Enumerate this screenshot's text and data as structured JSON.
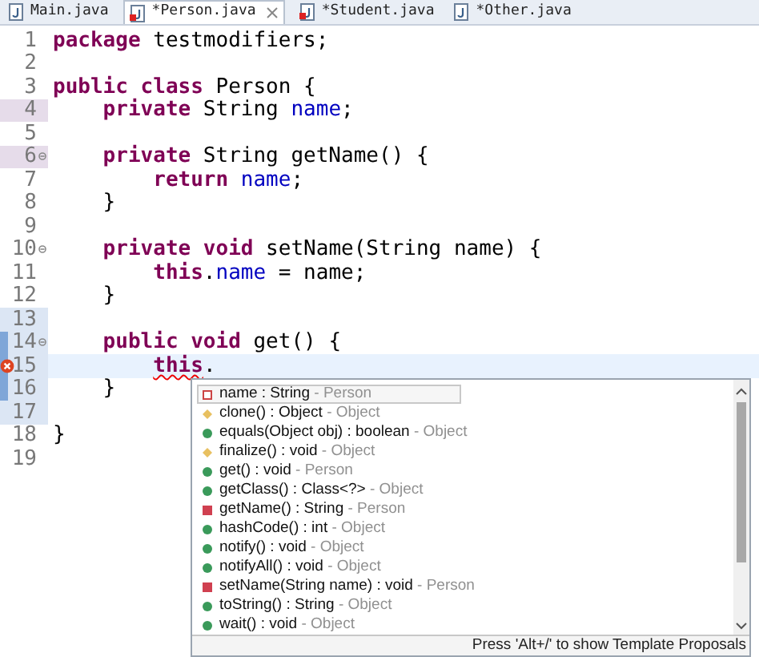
{
  "tabs": [
    {
      "label": "Main.java",
      "selected": false,
      "error": false,
      "closable": false
    },
    {
      "label": "*Person.java",
      "selected": true,
      "error": true,
      "closable": true
    },
    {
      "label": "*Student.java",
      "selected": false,
      "error": true,
      "closable": false
    },
    {
      "label": "*Other.java",
      "selected": false,
      "error": false,
      "closable": false
    }
  ],
  "editor": {
    "lines": [
      {
        "number": "1",
        "tokens": [
          {
            "text": "package",
            "kind": "keyword"
          },
          {
            "text": " testmodifiers;",
            "kind": "plain"
          }
        ]
      },
      {
        "number": "2"
      },
      {
        "number": "3",
        "tokens": [
          {
            "text": "public class",
            "kind": "keyword"
          },
          {
            "text": " Person {",
            "kind": "plain"
          }
        ]
      },
      {
        "number": "4",
        "kind": "occurrence",
        "tokens": [
          {
            "text": "    private",
            "kind": "keyword"
          },
          {
            "text": " String ",
            "kind": "plain"
          },
          {
            "text": "name",
            "kind": "field"
          },
          {
            "text": ";",
            "kind": "plain"
          }
        ]
      },
      {
        "number": "5"
      },
      {
        "number": "6",
        "kind": "occurrence",
        "fold": true,
        "tokens": [
          {
            "text": "    private",
            "kind": "keyword"
          },
          {
            "text": " String getName() {",
            "kind": "plain"
          }
        ]
      },
      {
        "number": "7",
        "tokens": [
          {
            "text": "        return ",
            "kind": "keyword"
          },
          {
            "text": "name",
            "kind": "field"
          },
          {
            "text": ";",
            "kind": "plain"
          }
        ]
      },
      {
        "number": "8",
        "tokens": [
          {
            "text": "    }",
            "kind": "plain"
          }
        ]
      },
      {
        "number": "9"
      },
      {
        "number": "10",
        "fold": true,
        "tokens": [
          {
            "text": "    private void",
            "kind": "keyword"
          },
          {
            "text": " setName(String name) {",
            "kind": "plain"
          }
        ]
      },
      {
        "number": "11",
        "tokens": [
          {
            "text": "        this",
            "kind": "keyword"
          },
          {
            "text": ".",
            "kind": "plain"
          },
          {
            "text": "name",
            "kind": "field"
          },
          {
            "text": " = name;",
            "kind": "plain"
          }
        ]
      },
      {
        "number": "12",
        "tokens": [
          {
            "text": "    }",
            "kind": "plain"
          }
        ]
      },
      {
        "number": "13",
        "kind": "edited"
      },
      {
        "number": "14",
        "kind": "added",
        "fold": true,
        "tokens": [
          {
            "text": "    public void",
            "kind": "keyword"
          },
          {
            "text": " get() {",
            "kind": "plain"
          }
        ]
      },
      {
        "number": "15",
        "kind": "added",
        "error": true,
        "current": true,
        "tokens": [
          {
            "text": "        this",
            "kind": "keyword_error"
          },
          {
            "text": ".",
            "kind": "plain"
          }
        ]
      },
      {
        "number": "16",
        "kind": "added",
        "tokens": [
          {
            "text": "    }",
            "kind": "plain"
          }
        ]
      },
      {
        "number": "17",
        "kind": "edited"
      },
      {
        "number": "18",
        "tokens": [
          {
            "text": "}",
            "kind": "plain"
          }
        ]
      },
      {
        "number": "19"
      }
    ]
  },
  "proposals": {
    "items": [
      {
        "kind": "field_private",
        "signature": "name : String",
        "owner": "- Person",
        "selected": true
      },
      {
        "kind": "method_protected",
        "signature": "clone() : Object",
        "owner": "- Object",
        "selected": false
      },
      {
        "kind": "method_public",
        "signature": "equals(Object obj) : boolean",
        "owner": "- Object",
        "selected": false
      },
      {
        "kind": "method_protected",
        "signature": "finalize() : void",
        "owner": "- Object",
        "selected": false
      },
      {
        "kind": "method_public",
        "signature": "get() : void",
        "owner": "- Person",
        "selected": false
      },
      {
        "kind": "method_public",
        "signature": "getClass() : Class<?>",
        "owner": "- Object",
        "selected": false
      },
      {
        "kind": "method_private",
        "signature": "getName() : String",
        "owner": "- Person",
        "selected": false
      },
      {
        "kind": "method_public",
        "signature": "hashCode() : int",
        "owner": "- Object",
        "selected": false
      },
      {
        "kind": "method_public",
        "signature": "notify() : void",
        "owner": "- Object",
        "selected": false
      },
      {
        "kind": "method_public",
        "signature": "notifyAll() : void",
        "owner": "- Object",
        "selected": false
      },
      {
        "kind": "method_private",
        "signature": "setName(String name) : void",
        "owner": "- Person",
        "selected": false
      },
      {
        "kind": "method_public",
        "signature": "toString() : String",
        "owner": "- Object",
        "selected": false
      },
      {
        "kind": "method_public",
        "signature": "wait() : void",
        "owner": "- Object",
        "selected": false
      }
    ],
    "hint": "Press 'Alt+/' to show Template Proposals"
  }
}
